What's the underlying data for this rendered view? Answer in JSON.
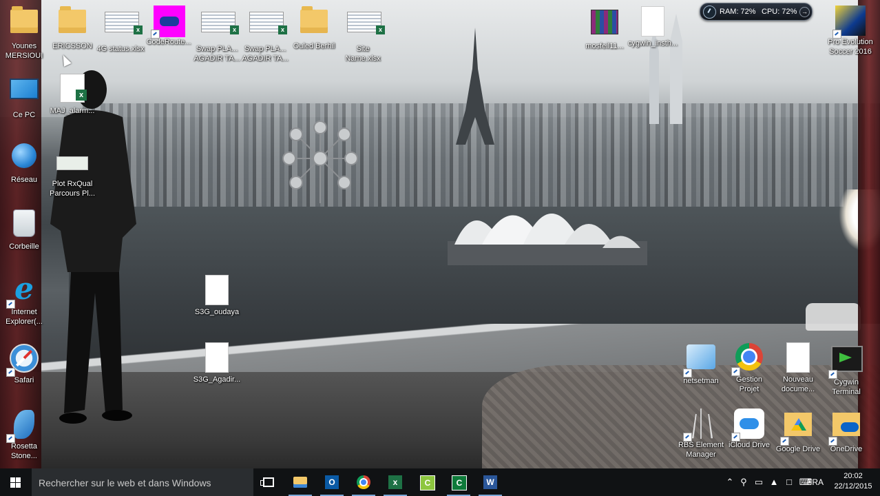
{
  "desktop": {
    "icons": [
      {
        "label": "Younes\nMERSIOUI"
      },
      {
        "label": "ERICSSON"
      },
      {
        "label": "4G status.xlsx"
      },
      {
        "label": "CodeRoute..."
      },
      {
        "label": "Swap PLA...\nAGADIR TA..."
      },
      {
        "label": "Swap PLA...\nAGADIR TA..."
      },
      {
        "label": "Ouled Berhil"
      },
      {
        "label": "Site\nName.xlsx"
      },
      {
        "label": "mosfeil11..."
      },
      {
        "label": "cygwin_insth..."
      },
      {
        "label": "Pro Evolution\nSoccer 2016"
      },
      {
        "label": "Ce PC"
      },
      {
        "label": "MAJ_alarm..."
      },
      {
        "label": "Réseau"
      },
      {
        "label": "Plot RxQual\nParcours Pl..."
      },
      {
        "label": "Corbeille"
      },
      {
        "label": "Internet\nExplorer(..."
      },
      {
        "label": "S3G_oudaya"
      },
      {
        "label": "Safari"
      },
      {
        "label": "S3G_Agadir..."
      },
      {
        "label": "Rosetta\nStone..."
      },
      {
        "label": "netsetman"
      },
      {
        "label": "Gestion\nProjet"
      },
      {
        "label": "Nouveau\ndocume..."
      },
      {
        "label": "Cygwin\nTerminal"
      },
      {
        "label": "RBS Element\nManager"
      },
      {
        "label": "iCloud Drive"
      },
      {
        "label": "Google Drive"
      },
      {
        "label": "OneDrive"
      }
    ]
  },
  "monitor": {
    "ram": "RAM: 72%",
    "cpu": "CPU: 72%",
    "ram_percent": 72,
    "cpu_percent": 72
  },
  "taskbar": {
    "search_placeholder": "Rechercher sur le web et dans Windows",
    "pinned": [
      "task-view",
      "file-explorer",
      "outlook",
      "chrome",
      "excel",
      "camtasia",
      "excel-2",
      "word"
    ],
    "language": "FRA",
    "time": "20:02",
    "date": "22/12/2015"
  },
  "colors": {
    "taskbar": "#101214",
    "search_box": "#2a2d30",
    "excel_green": "#1e7145",
    "accent": "#7aa7d8"
  }
}
